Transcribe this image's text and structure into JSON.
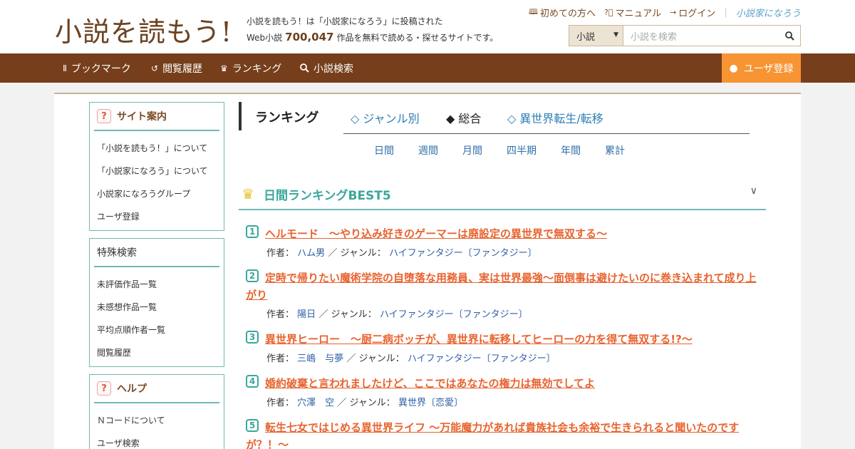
{
  "header": {
    "logo": "小説を読もう!",
    "tagline_line1": "小説を読もう！は「小説家になろう」に投稿された",
    "tagline_line2_prefix": "Web小説",
    "tagline_count": "700,047",
    "tagline_line2_suffix": "作品を無料で読める・探せるサイトです。",
    "links": [
      {
        "icon": "book-icon",
        "label": "初めての方へ"
      },
      {
        "icon": "question-icon",
        "label": "マニュアル"
      },
      {
        "icon": "login-icon",
        "label": "ログイン"
      }
    ],
    "partner_logo": "小説家になろう",
    "search": {
      "select_value": "小説",
      "placeholder": "小説を検索"
    }
  },
  "nav": {
    "items": [
      {
        "icon": "bookmark-icon",
        "label": "ブックマーク"
      },
      {
        "icon": "history-icon",
        "label": "閲覧履歴"
      },
      {
        "icon": "crown-icon",
        "label": "ランキング"
      },
      {
        "icon": "search-icon",
        "label": "小説検索"
      }
    ],
    "register": "ユーザ登録"
  },
  "sidebar": {
    "site_guide": {
      "title": "サイト案内",
      "items": [
        "「小説を読もう！」について",
        "「小説家になろう」について",
        "小説家になろうグループ",
        "ユーザ登録"
      ]
    },
    "special_search": {
      "title": "特殊検索",
      "items": [
        "未評価作品一覧",
        "未感想作品一覧",
        "平均点順作者一覧",
        "閲覧履歴"
      ]
    },
    "help": {
      "title": "ヘルプ",
      "items": [
        "Ｎコードについて",
        "ユーザ検索"
      ]
    }
  },
  "ranking": {
    "title": "ランキング",
    "tabs": [
      {
        "label": "◇ ジャンル別",
        "active": false
      },
      {
        "label": "◆ 総合",
        "active": true
      },
      {
        "label": "◇ 異世界転生/転移",
        "active": false
      }
    ],
    "periods": [
      "日間",
      "週間",
      "月間",
      "四半期",
      "年間",
      "累計"
    ],
    "best_title": "日間ランキングBEST5",
    "labels": {
      "author": "作者：",
      "genre": "／ ジャンル："
    },
    "entries": [
      {
        "rank": "1",
        "title": "ヘルモード　～やり込み好きのゲーマーは廃設定の異世界で無双する～",
        "author": "ハム男",
        "genre": "ハイファンタジー〔ファンタジー〕"
      },
      {
        "rank": "2",
        "title": "定時で帰りたい魔術学院の自堕落な用務員、実は世界最強～面倒事は避けたいのに巻き込まれて成り上がり",
        "author": "陽日",
        "genre": "ハイファンタジー〔ファンタジー〕"
      },
      {
        "rank": "3",
        "title": "異世界ヒーロー　～厨二病ボッチが、異世界に転移してヒーローの力を得て無双する!?～",
        "author": "三嶋　与夢",
        "genre": "ハイファンタジー〔ファンタジー〕"
      },
      {
        "rank": "4",
        "title": "婚約破棄と言われましたけど、ここではあなたの権力は無効でしてよ",
        "author": "穴澤　空",
        "genre": "異世界〔恋愛〕"
      },
      {
        "rank": "5",
        "title": "転生七女ではじめる異世界ライフ 〜万能魔力があれば貴族社会も余裕で生きられると聞いたのですが？！〜",
        "author": "",
        "genre": ""
      }
    ]
  },
  "colors": {
    "brand_brown": "#763e1b",
    "accent_orange": "#f79433",
    "teal": "#3aa79c",
    "title_orange": "#e8632f"
  }
}
